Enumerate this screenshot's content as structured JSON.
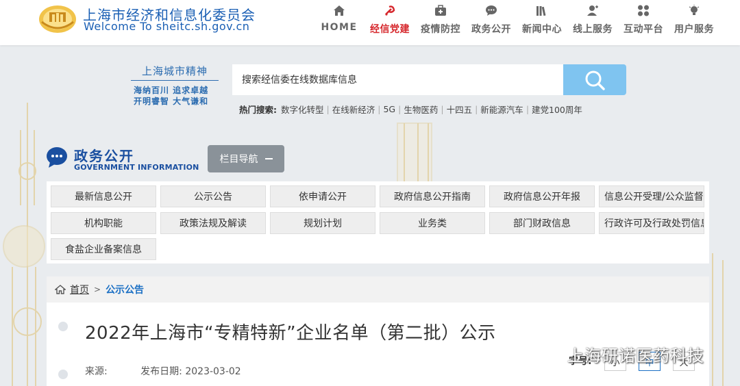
{
  "header": {
    "title": "上海市经济和信息化委员会",
    "url": "Welcome To sheitc.sh.gov.cn"
  },
  "nav": [
    {
      "label": "HOME",
      "icon": "home-icon"
    },
    {
      "label": "经信党建",
      "icon": "party-icon",
      "active": true
    },
    {
      "label": "疫情防控",
      "icon": "medkit-icon"
    },
    {
      "label": "政务公开",
      "icon": "chat-icon"
    },
    {
      "label": "新闻中心",
      "icon": "books-icon"
    },
    {
      "label": "线上服务",
      "icon": "user-icon"
    },
    {
      "label": "互动平台",
      "icon": "grid-icon"
    },
    {
      "label": "用户服务",
      "icon": "bulb-icon"
    }
  ],
  "slogan": {
    "title": "上海城市精神",
    "line1": "海纳百川 追求卓越",
    "line2": "开明睿智 大气谦和"
  },
  "search": {
    "placeholder": "搜索经信委在线数据库信息",
    "hot_label": "热门搜索:",
    "hot_keywords": [
      "数字化转型",
      "在线新经济",
      "5G",
      "生物医药",
      "十四五",
      "新能源汽车",
      "建党100周年"
    ]
  },
  "gov_info": {
    "title": "政务公开",
    "subtitle": "GOVERNMENT INFORMATION",
    "column_nav": "栏目导航"
  },
  "categories": [
    [
      "最新信息公开",
      "公示公告",
      "依申请公开",
      "政府信息公开指南",
      "政府信息公开年报",
      "信息公开受理/公众监督"
    ],
    [
      "机构职能",
      "政策法规及解读",
      "规划计划",
      "业务类",
      "部门财政信息",
      "行政许可及行政处罚信息"
    ],
    [
      "食盐企业备案信息"
    ]
  ],
  "breadcrumb": {
    "home": "首页",
    "separator": ">",
    "current": "公示公告"
  },
  "article": {
    "title": "2022年上海市“专精特新”企业名单（第二批）公示",
    "source_label": "来源:",
    "date_label": "发布日期:",
    "date": "2023-03-02",
    "font_label": "字号:",
    "font_sizes": [
      "小",
      "中",
      "大"
    ]
  },
  "watermark": "上海研诺医药科技",
  "colors": {
    "brand_blue": "#1a5fb4",
    "active_red": "#d6282d",
    "search_button": "#7fc4f0"
  }
}
